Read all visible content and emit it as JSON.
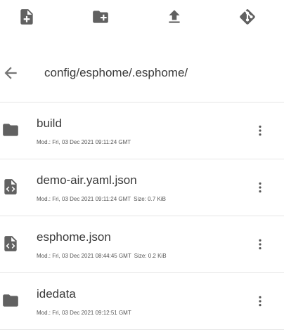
{
  "toolbar": {
    "buttons": [
      {
        "icon": "new-file-icon"
      },
      {
        "icon": "new-folder-icon"
      },
      {
        "icon": "upload-icon"
      },
      {
        "icon": "git-icon"
      }
    ]
  },
  "path": {
    "back_icon": "arrow-left-icon",
    "current": "config/esphome/.esphome/"
  },
  "files": [
    {
      "name": "build",
      "type": "folder",
      "modified": "Mod.: Fri, 03 Dec 2021 09:11:24 GMT",
      "size": ""
    },
    {
      "name": "demo-air.yaml.json",
      "type": "code-file",
      "modified": "Mod.: Fri, 03 Dec 2021 09:11:24 GMT",
      "size": "Size: 0.7 KiB"
    },
    {
      "name": "esphome.json",
      "type": "code-file",
      "modified": "Mod.: Fri, 03 Dec 2021 08:44:45 GMT",
      "size": "Size: 0.2 KiB"
    },
    {
      "name": "idedata",
      "type": "folder",
      "modified": "Mod.: Fri, 03 Dec 2021 09:12:51 GMT",
      "size": ""
    }
  ],
  "colors": {
    "icon": "#616161",
    "text": "#3a3a3a",
    "divider": "#e6e6e6"
  }
}
